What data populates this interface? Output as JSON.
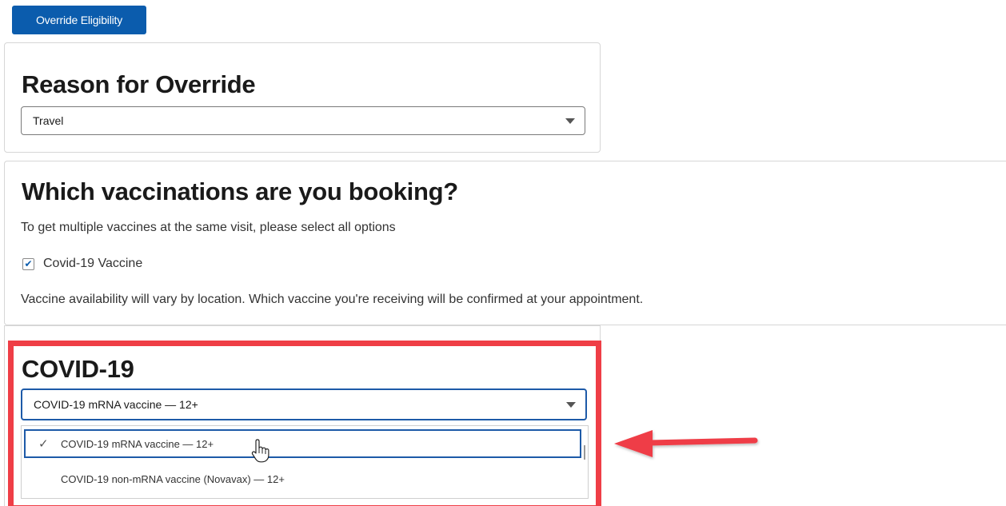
{
  "toolbar": {
    "override_button": "Override Eligibility"
  },
  "reason_section": {
    "title": "Reason for Override",
    "selected_value": "Travel"
  },
  "vaccination_section": {
    "title": "Which vaccinations are you booking?",
    "help_text": "To get multiple vaccines at the same visit, please select all options",
    "checkbox_label": "Covid-19 Vaccine",
    "checkbox_checked": true,
    "note": "Vaccine availability will vary by location. Which vaccine you're receiving will be confirmed at your appointment."
  },
  "covid_section": {
    "title": "COVID-19",
    "selected_value": "COVID-19 mRNA vaccine — 12+",
    "options": [
      {
        "label": "COVID-19 mRNA vaccine — 12+",
        "selected": true
      },
      {
        "label": "COVID-19 non-mRNA vaccine (Novavax) — 12+",
        "selected": false
      }
    ]
  },
  "icons": {
    "caret": "chevron-down-icon",
    "check": "checkmark-icon",
    "cursor": "hand-pointer-icon",
    "arrow": "left-arrow-icon"
  },
  "colors": {
    "primary": "#0b5cad",
    "focus_border": "#1d5aa8",
    "annotation_red": "#ef3e46"
  }
}
